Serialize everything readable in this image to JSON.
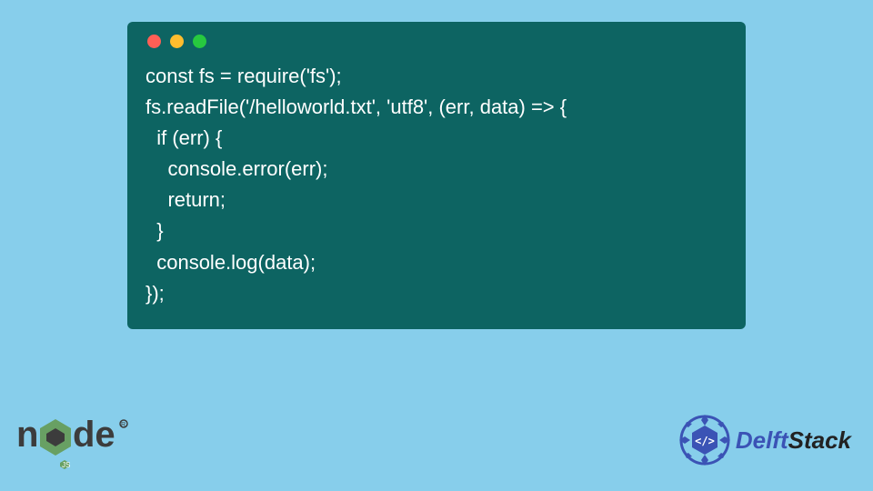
{
  "code": {
    "lines": [
      "const fs = require('fs');",
      "fs.readFile('/helloworld.txt', 'utf8', (err, data) => {",
      "  if (err) {",
      "    console.error(err);",
      "    return;",
      "  }",
      "  console.log(data);",
      "});"
    ]
  },
  "logos": {
    "node": "node",
    "delft_part1": "Delft",
    "delft_part2": "Stack"
  },
  "colors": {
    "page_bg": "#87ceeb",
    "window_bg": "#0d6462",
    "code_fg": "#ffffff",
    "node_green": "#68a063",
    "node_dark": "#3c3c3c",
    "delft_blue": "#3b53b5"
  }
}
